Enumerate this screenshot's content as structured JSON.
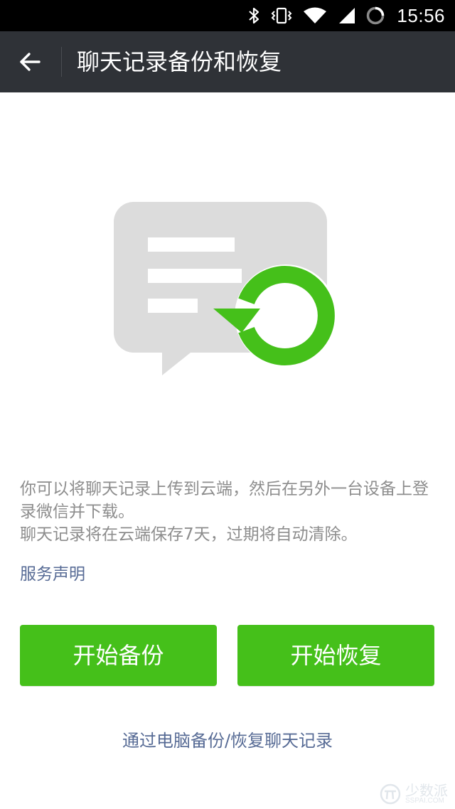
{
  "status_bar": {
    "time": "15:56",
    "icons": [
      "bluetooth-icon",
      "vibrate-icon",
      "wifi-icon",
      "signal-icon",
      "sync-icon"
    ]
  },
  "header": {
    "title": "聊天记录备份和恢复",
    "back_icon": "arrow-left-icon"
  },
  "illustration": {
    "icon": "chat-backup-restore-icon",
    "colors": {
      "bubble": "#dcdcdc",
      "lines": "#ffffff",
      "restore": "#45c01a"
    }
  },
  "description": {
    "line1": "你可以将聊天记录上传到云端，然后在另外一台设备上登录微信并下载。",
    "line2": "聊天记录将在云端保存7天，过期将自动清除。"
  },
  "links": {
    "service": "服务声明",
    "pc_backup": "通过电脑备份/恢复聊天记录"
  },
  "buttons": {
    "start_backup": "开始备份",
    "start_restore": "开始恢复"
  },
  "watermark": {
    "text": "少数派",
    "sub": "SSPAI.COM"
  },
  "colors": {
    "accent": "#45c01a",
    "header_bg": "#2f3237",
    "link": "#576b95",
    "text_secondary": "#8d8d8d"
  }
}
